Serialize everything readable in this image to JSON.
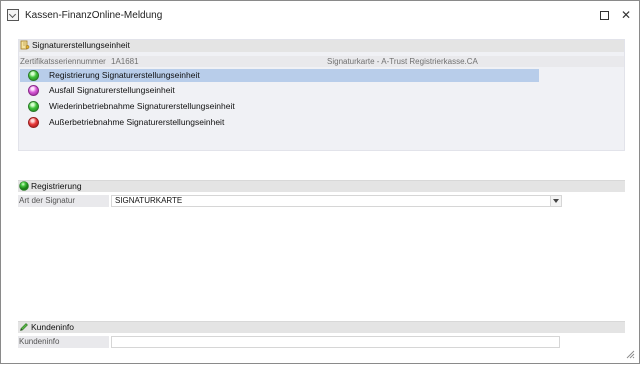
{
  "window": {
    "title": "Kassen-FinanzOnline-Meldung"
  },
  "signatur_section": {
    "header": "Signaturerstellungseinheit",
    "cert_label": "Zertifikatsseriennummer",
    "cert_value": "1A1681",
    "card_info": "Signaturkarte - A-Trust Registrierkasse.CA",
    "options": [
      {
        "label": "Registrierung Signaturerstellungseinheit",
        "status_color": "#3fc23a",
        "selected": true
      },
      {
        "label": "Ausfall Signaturerstellungseinheit",
        "status_color": "#d85ad8",
        "selected": false
      },
      {
        "label": "Wiederinbetriebnahme Signaturerstellungseinheit",
        "status_color": "#3fc23a",
        "selected": false
      },
      {
        "label": "Außerbetriebnahme Signaturerstellungseinheit",
        "status_color": "#e83b3b",
        "selected": false
      }
    ]
  },
  "registrierung_section": {
    "header": "Registrierung",
    "art_label": "Art der Signatur",
    "art_value": "SIGNATURKARTE"
  },
  "kundeninfo_section": {
    "header": "Kundeninfo",
    "field_label": "Kundeninfo",
    "field_value": ""
  },
  "colors": {
    "selection": "#b8cdea",
    "section_header_bg": "#e4e4e4",
    "panel_bg": "#f0f1f5"
  },
  "icons": [
    "app-icon",
    "maximize-icon",
    "close-icon",
    "certificate-icon",
    "status-dot-icon",
    "pencil-icon",
    "dropdown-arrow-icon",
    "resize-grip-icon"
  ]
}
